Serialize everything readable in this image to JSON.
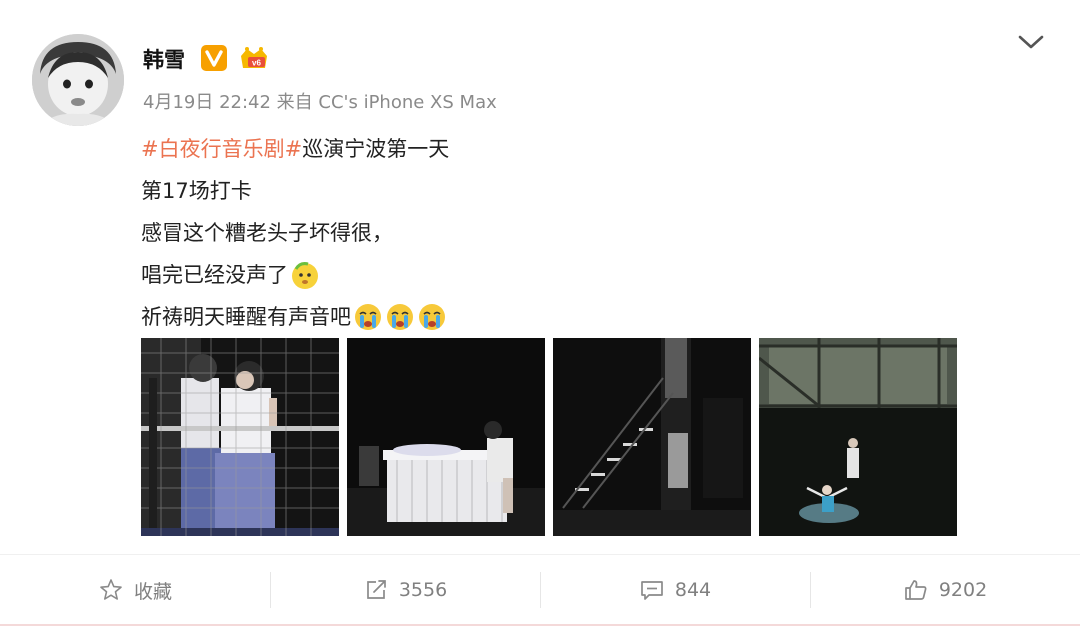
{
  "post": {
    "username": "韩雪",
    "meta": "4月19日 22:42 来自 CC's iPhone XS Max",
    "hashtag": "#白夜行音乐剧#",
    "line1_rest": " 巡演宁波第一天",
    "line2": "第17场打卡",
    "line3": "感冒这个糟老头子坏得很，",
    "line4": "唱完已经没声了",
    "line5": "祈祷明天睡醒有声音吧"
  },
  "badges": {
    "verified": "v-verified-icon",
    "vip": "vip-crown-icon"
  },
  "colors": {
    "hashtag": "#eb7350",
    "verified": "#f7a000",
    "meta": "#8a8a8a"
  },
  "photos": [
    {
      "name": "photo-cage-scene"
    },
    {
      "name": "photo-bed-scene"
    },
    {
      "name": "photo-stairs-scene"
    },
    {
      "name": "photo-dancer-scene"
    }
  ],
  "actions": {
    "favorite_label": "收藏",
    "repost_count": "3556",
    "comment_count": "844",
    "like_count": "9202"
  }
}
